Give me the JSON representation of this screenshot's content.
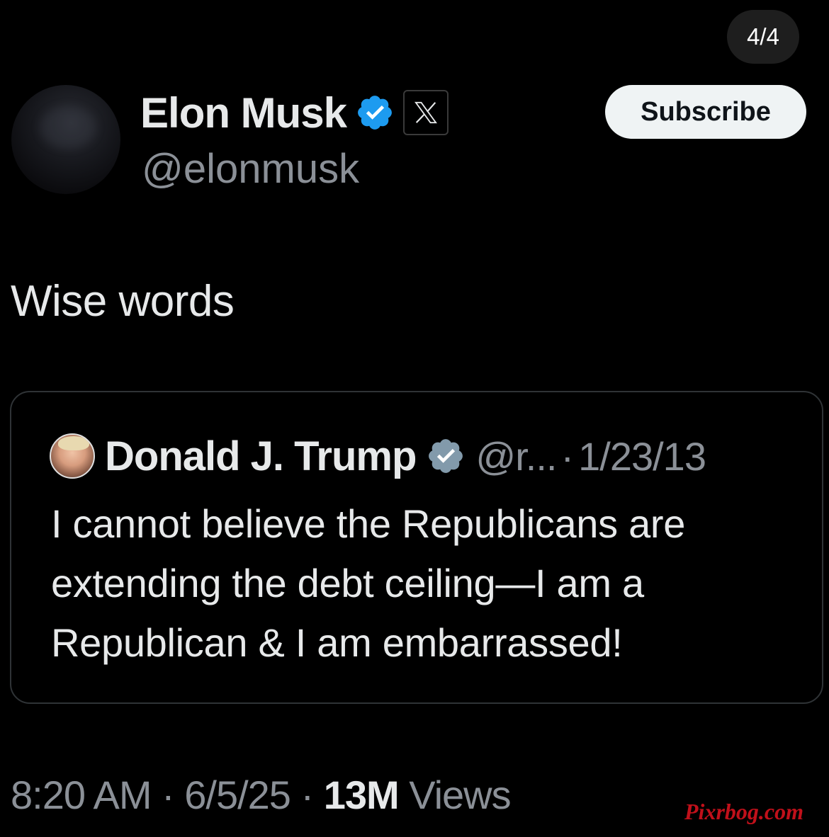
{
  "pager": {
    "label": "4/4"
  },
  "post": {
    "author_name": "Elon Musk",
    "author_handle": "@elonmusk",
    "affiliation_badge": "x-logo-icon",
    "subscribe_label": "Subscribe",
    "text": "Wise words",
    "time": "8:20 AM",
    "separator": "·",
    "date": "6/5/25",
    "views_count": "13M",
    "views_label": "Views"
  },
  "quoted_post": {
    "author_name": "Donald J. Trump",
    "author_handle": "@r...",
    "separator": "·",
    "date": "1/23/13",
    "text": "I cannot believe the Republicans are extending the debt ceiling—I am a Republican & I am embarrassed!"
  },
  "watermark": {
    "text": "Pixrbog.com"
  },
  "colors": {
    "background": "#000000",
    "primary_text": "#e7e9ea",
    "secondary_text": "#8b9097",
    "verified_blue": "#1d9bf0",
    "verified_gray": "#829aab",
    "subscribe_bg": "#eff3f4",
    "watermark": "#c0101a"
  },
  "icons": {
    "verified_main": "verified-blue-icon",
    "verified_quote": "verified-gray-icon"
  }
}
